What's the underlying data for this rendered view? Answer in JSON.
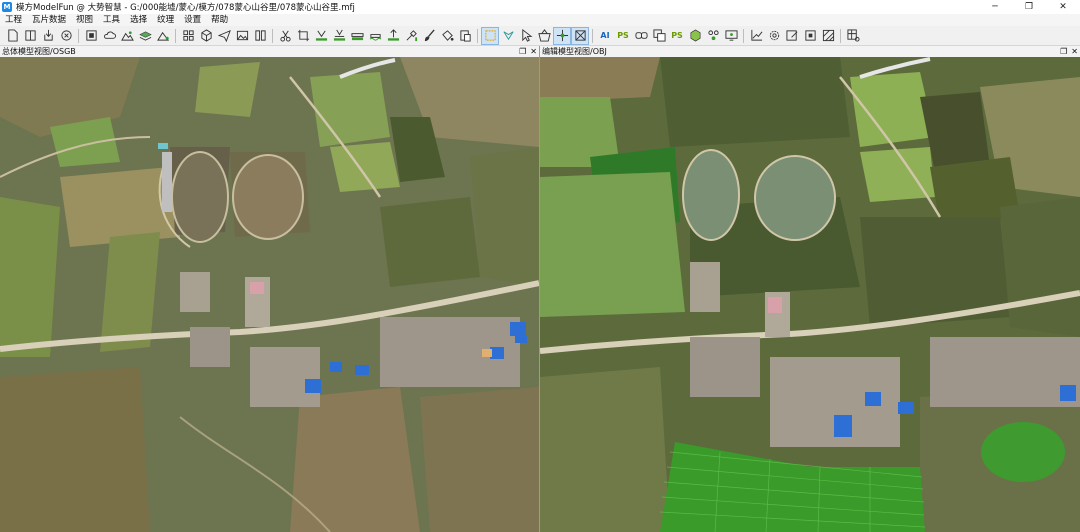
{
  "window": {
    "title": "模方ModelFun @ 大势智慧 - G:/000能墟/蒙心/模方/078蒙心山谷里/078蒙心山谷里.mfj",
    "app_icon": "app-logo-icon",
    "controls": [
      "─",
      "❐",
      "✕"
    ]
  },
  "menu": [
    "工程",
    "瓦片数据",
    "视图",
    "工具",
    "选择",
    "纹理",
    "设置",
    "帮助"
  ],
  "toolbar": {
    "groups": [
      [
        "new-file-icon",
        "split-view-icon",
        "export-icon",
        "close-circle-icon"
      ],
      [
        "stop-icon",
        "cloud-icon",
        "terrain-icon",
        "layers-icon",
        "mountain-icon"
      ],
      [
        "grid-icon",
        "cube-icon",
        "plane-icon",
        "image-icon",
        "book-icon"
      ],
      [
        "scissors-icon",
        "crop-icon",
        "flatten-icon",
        "flatten-alt-icon",
        "bridge-icon",
        "water-icon",
        "height-icon",
        "repair-icon",
        "brush-icon",
        "bucket-icon",
        "paste-icon"
      ],
      [
        "select-rect-icon",
        "select-poly-icon",
        "cursor-icon",
        "basket-icon",
        "cross-icon",
        "fit-icon"
      ],
      [
        "ai-text-icon",
        "ps-icon",
        "link-icon",
        "copy-icon",
        "ps-alt-icon",
        "box-icon",
        "nodes-icon",
        "monitor-icon"
      ],
      [
        "chart-icon",
        "gear-icon",
        "edit-icon",
        "frame-icon",
        "hatch-icon"
      ],
      [
        "table-settings-icon"
      ]
    ],
    "ai_label": "AI",
    "ps_label": "PS"
  },
  "panes": {
    "left": {
      "title": "总体模型视图/OSGB"
    },
    "right": {
      "title": "编辑模型视图/OBJ"
    },
    "ctrl_restore": "❐",
    "ctrl_close": "✕"
  },
  "colors": {
    "accent": "#1e88e5",
    "terrain": "#6d7450",
    "field": "#8a9a52",
    "road": "#d8d0b8",
    "water": "#7a8f74",
    "roof_blue": "#2e6fd6",
    "flatten_green": "#3a9a2a"
  }
}
